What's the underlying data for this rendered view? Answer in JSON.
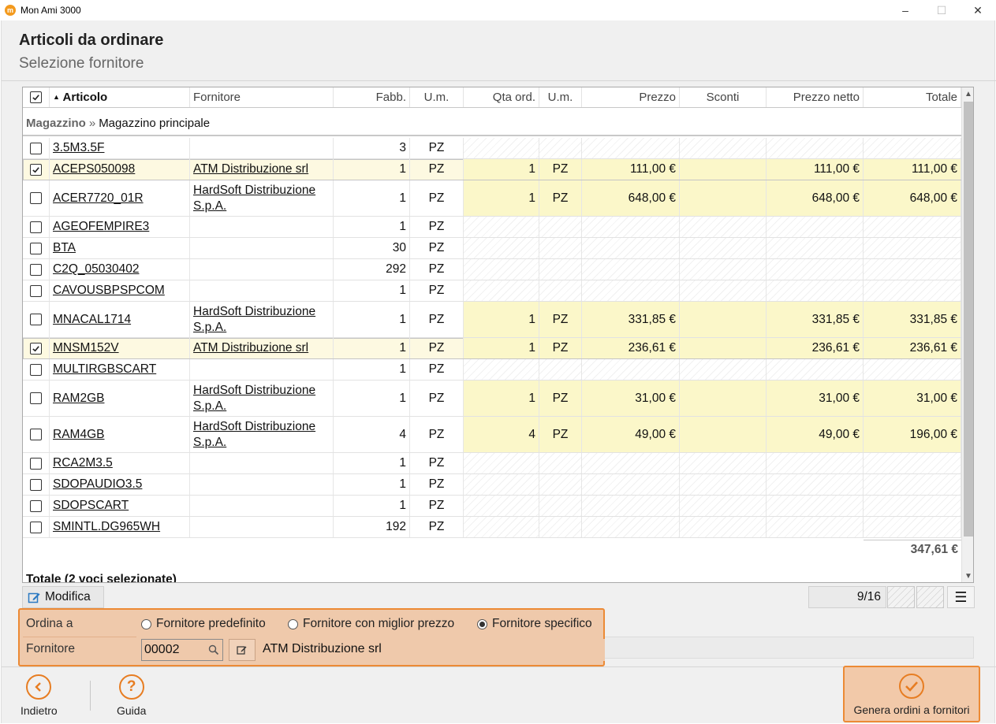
{
  "window": {
    "title": "Mon Ami 3000",
    "icon_letter": "m"
  },
  "header": {
    "title": "Articoli da ordinare",
    "subtitle": "Selezione fornitore"
  },
  "grid": {
    "columns": {
      "articolo": "Articolo",
      "fornitore": "Fornitore",
      "fabb": "Fabb.",
      "um": "U.m.",
      "qta_ord": "Qta ord.",
      "um2": "U.m.",
      "prezzo": "Prezzo",
      "sconti": "Sconti",
      "prezzo_netto": "Prezzo netto",
      "totale": "Totale"
    },
    "group": {
      "key": "Magazzino",
      "separator": "»",
      "value": "Magazzino principale"
    },
    "rows": [
      {
        "checked": false,
        "articolo": "3.5M3.5F",
        "fornitore": "",
        "fabb": "3",
        "um": "PZ",
        "qta": "",
        "um2": "",
        "prezzo": "",
        "sconti": "",
        "netto": "",
        "totale": ""
      },
      {
        "checked": true,
        "articolo": "ACEPS050098",
        "fornitore": "ATM Distribuzione srl",
        "fabb": "1",
        "um": "PZ",
        "qta": "1",
        "um2": "PZ",
        "prezzo": "111,00 €",
        "sconti": "",
        "netto": "111,00 €",
        "totale": "111,00 €"
      },
      {
        "checked": false,
        "articolo": "ACER7720_01R",
        "fornitore": "HardSoft Distribuzione S.p.A.",
        "fabb": "1",
        "um": "PZ",
        "qta": "1",
        "um2": "PZ",
        "prezzo": "648,00 €",
        "sconti": "",
        "netto": "648,00 €",
        "totale": "648,00 €"
      },
      {
        "checked": false,
        "articolo": "AGEOFEMPIRE3",
        "fornitore": "",
        "fabb": "1",
        "um": "PZ",
        "qta": "",
        "um2": "",
        "prezzo": "",
        "sconti": "",
        "netto": "",
        "totale": ""
      },
      {
        "checked": false,
        "articolo": "BTA",
        "fornitore": "",
        "fabb": "30",
        "um": "PZ",
        "qta": "",
        "um2": "",
        "prezzo": "",
        "sconti": "",
        "netto": "",
        "totale": ""
      },
      {
        "checked": false,
        "articolo": "C2Q_05030402",
        "fornitore": "",
        "fabb": "292",
        "um": "PZ",
        "qta": "",
        "um2": "",
        "prezzo": "",
        "sconti": "",
        "netto": "",
        "totale": ""
      },
      {
        "checked": false,
        "articolo": "CAVOUSBPSPCOM",
        "fornitore": "",
        "fabb": "1",
        "um": "PZ",
        "qta": "",
        "um2": "",
        "prezzo": "",
        "sconti": "",
        "netto": "",
        "totale": ""
      },
      {
        "checked": false,
        "articolo": "MNACAL1714",
        "fornitore": "HardSoft Distribuzione S.p.A.",
        "fabb": "1",
        "um": "PZ",
        "qta": "1",
        "um2": "PZ",
        "prezzo": "331,85 €",
        "sconti": "",
        "netto": "331,85 €",
        "totale": "331,85 €"
      },
      {
        "checked": true,
        "articolo": "MNSM152V",
        "fornitore": "ATM Distribuzione srl",
        "fabb": "1",
        "um": "PZ",
        "qta": "1",
        "um2": "PZ",
        "prezzo": "236,61 €",
        "sconti": "",
        "netto": "236,61 €",
        "totale": "236,61 €"
      },
      {
        "checked": false,
        "articolo": "MULTIRGBSCART",
        "fornitore": "",
        "fabb": "1",
        "um": "PZ",
        "qta": "",
        "um2": "",
        "prezzo": "",
        "sconti": "",
        "netto": "",
        "totale": ""
      },
      {
        "checked": false,
        "articolo": "RAM2GB",
        "fornitore": "HardSoft Distribuzione S.p.A.",
        "fabb": "1",
        "um": "PZ",
        "qta": "1",
        "um2": "PZ",
        "prezzo": "31,00 €",
        "sconti": "",
        "netto": "31,00 €",
        "totale": "31,00 €"
      },
      {
        "checked": false,
        "articolo": "RAM4GB",
        "fornitore": "HardSoft Distribuzione S.p.A.",
        "fabb": "4",
        "um": "PZ",
        "qta": "4",
        "um2": "PZ",
        "prezzo": "49,00 €",
        "sconti": "",
        "netto": "49,00 €",
        "totale": "196,00 €"
      },
      {
        "checked": false,
        "articolo": "RCA2M3.5",
        "fornitore": "",
        "fabb": "1",
        "um": "PZ",
        "qta": "",
        "um2": "",
        "prezzo": "",
        "sconti": "",
        "netto": "",
        "totale": ""
      },
      {
        "checked": false,
        "articolo": "SDOPAUDIO3.5",
        "fornitore": "",
        "fabb": "1",
        "um": "PZ",
        "qta": "",
        "um2": "",
        "prezzo": "",
        "sconti": "",
        "netto": "",
        "totale": ""
      },
      {
        "checked": false,
        "articolo": "SDOPSCART",
        "fornitore": "",
        "fabb": "1",
        "um": "PZ",
        "qta": "",
        "um2": "",
        "prezzo": "",
        "sconti": "",
        "netto": "",
        "totale": ""
      },
      {
        "checked": false,
        "articolo": "SMINTL.DG965WH",
        "fornitore": "",
        "fabb": "192",
        "um": "PZ",
        "qta": "",
        "um2": "",
        "prezzo": "",
        "sconti": "",
        "netto": "",
        "totale": ""
      }
    ],
    "group_total": "347,61 €",
    "total_label": "Totale (2 voci selezionate)"
  },
  "toolbar": {
    "modifica_label": "Modifica",
    "pager": "9/16"
  },
  "order": {
    "ordina_label": "Ordina a",
    "options": [
      "Fornitore predefinito",
      "Fornitore con miglior prezzo",
      "Fornitore specifico"
    ],
    "selected_option": 2,
    "fornitore_label": "Fornitore",
    "fornitore_code": "00002",
    "fornitore_name": "ATM Distribuzione srl"
  },
  "footer": {
    "back_label": "Indietro",
    "help_label": "Guida",
    "help_glyph": "?",
    "generate_label": "Genera ordini a fornitori"
  },
  "colors": {
    "accent": "#ec8a35",
    "selected_row": "#fbf7c9",
    "panel": "#efc9ab"
  }
}
